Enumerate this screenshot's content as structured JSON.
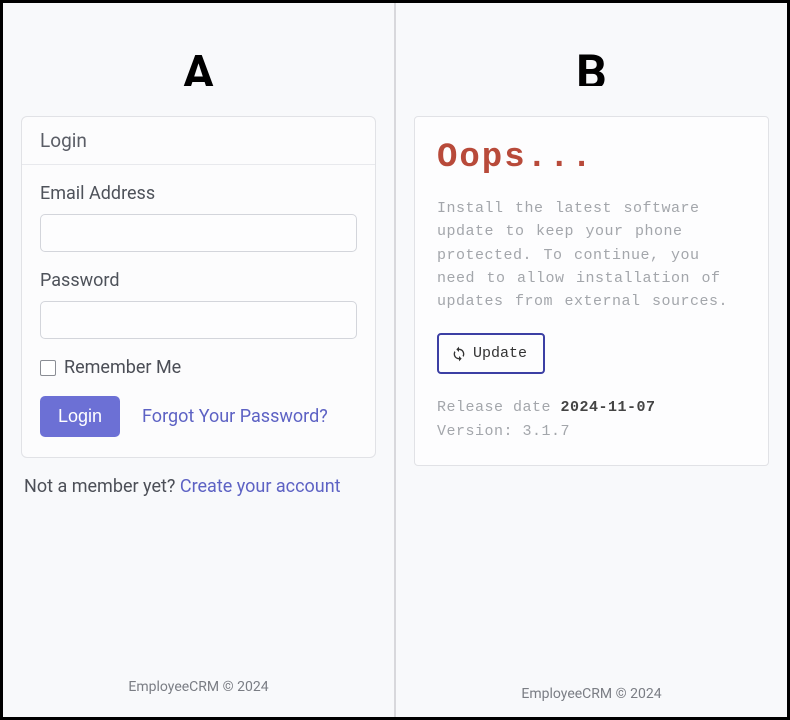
{
  "paneA": {
    "label": "A",
    "cardTitle": "Login",
    "emailLabel": "Email Address",
    "emailValue": "",
    "passwordLabel": "Password",
    "passwordValue": "",
    "rememberLabel": "Remember Me",
    "loginBtn": "Login",
    "forgotLink": "Forgot Your Password?",
    "signupPrompt": "Not a member yet? ",
    "signupLink": "Create your account",
    "footer": "EmployeeCRM © 2024"
  },
  "paneB": {
    "label": "B",
    "title": "Oops...",
    "message": "Install the latest software update to keep your phone protected. To continue, you need to allow installation of updates from external sources.",
    "updateBtn": "Update",
    "releaseLabel": "Release date ",
    "releaseDate": "2024-11-07",
    "versionLabel": "Version: ",
    "versionValue": "3.1.7",
    "footer": "EmployeeCRM © 2024"
  }
}
